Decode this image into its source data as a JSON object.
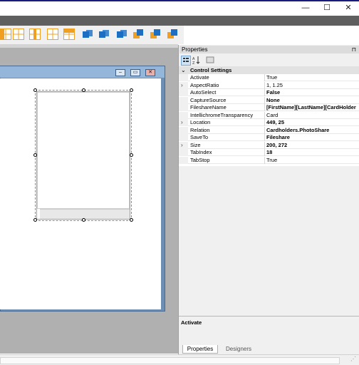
{
  "window": {
    "minimize_glyph": "—",
    "maximize_glyph": "☐",
    "close_glyph": "✕"
  },
  "toolbar": {
    "icons": [
      "align-left-icon",
      "align-center-icon",
      "align-middle-icon",
      "align-right-icon",
      "grid-icon",
      "send-back-icon",
      "group-icon",
      "order-icon",
      "bring-front-icon",
      "layer-icon",
      "connect-icon"
    ],
    "accent": "#f0a020",
    "blue": "#1c6fc3"
  },
  "form": {
    "mini_buttons": [
      "–",
      "▭",
      "✕"
    ]
  },
  "properties": {
    "title": "Properties",
    "pin_glyph": "⊓",
    "category": "Control Settings",
    "rows": [
      {
        "name": "Activate",
        "value": "True",
        "bold": false,
        "expand": false,
        "selected": true
      },
      {
        "name": "AspectRatio",
        "value": "1, 1.25",
        "bold": false,
        "expand": true
      },
      {
        "name": "AutoSelect",
        "value": "False",
        "bold": true,
        "expand": false
      },
      {
        "name": "CaptureSource",
        "value": "None",
        "bold": true,
        "expand": false
      },
      {
        "name": "FileshareName",
        "value": "[FirstName][LastName][CardHolder",
        "bold": true,
        "expand": false
      },
      {
        "name": "IntellichromeTransparency",
        "value": "Card",
        "bold": false,
        "expand": false
      },
      {
        "name": "Location",
        "value": "449, 25",
        "bold": true,
        "expand": true
      },
      {
        "name": "Relation",
        "value": "Cardholders.PhotoShare",
        "bold": true,
        "expand": false
      },
      {
        "name": "SaveTo",
        "value": "Fileshare",
        "bold": true,
        "expand": false
      },
      {
        "name": "Size",
        "value": "200, 272",
        "bold": true,
        "expand": true
      },
      {
        "name": "TabIndex",
        "value": "18",
        "bold": true,
        "expand": false
      },
      {
        "name": "TabStop",
        "value": "True",
        "bold": false,
        "expand": false
      }
    ],
    "description_title": "Activate",
    "tabs": [
      "Properties",
      "Designers"
    ]
  }
}
